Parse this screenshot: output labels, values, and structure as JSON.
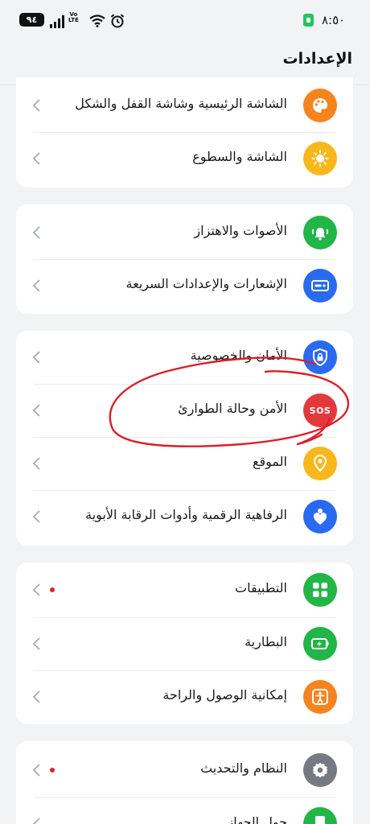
{
  "status_bar": {
    "battery_level": "٩٤",
    "volte_line1": "Vo",
    "volte_line2": "LTE",
    "time": "٨:٥٠"
  },
  "header": {
    "title": "الإعدادات"
  },
  "colors": {
    "orange": "#f5841f",
    "yellow": "#f8b81c",
    "green": "#22b547",
    "blue": "#2a6af0",
    "red": "#e23a3c",
    "gray": "#757a82",
    "annotation_red": "#d9202a"
  },
  "groups": [
    {
      "items": [
        {
          "label": "الشاشة الرئيسية وشاشة القفل والشكل",
          "icon": "palette-icon",
          "color": "#f5841f"
        },
        {
          "label": "الشاشة والسطوع",
          "icon": "sun-icon",
          "color": "#f8b81c"
        }
      ]
    },
    {
      "items": [
        {
          "label": "الأصوات والاهتزاز",
          "icon": "bell-icon",
          "color": "#22b547"
        },
        {
          "label": "الإشعارات والإعدادات السريعة",
          "icon": "notification-icon",
          "color": "#2a6af0"
        }
      ]
    },
    {
      "items": [
        {
          "label": "الأمان والخصوصية",
          "icon": "shield-lock-icon",
          "color": "#2a6af0"
        },
        {
          "label": "الأمن وحالة الطوارئ",
          "icon": "sos-icon",
          "color": "#e23a3c",
          "icon_text": "SOS"
        },
        {
          "label": "الموقع",
          "icon": "location-pin-icon",
          "color": "#f8b81c"
        },
        {
          "label": "الرفاهية الرقمية وأدوات الرقابة الأبوية",
          "icon": "wellbeing-icon",
          "color": "#2a6af0"
        }
      ]
    },
    {
      "items": [
        {
          "label": "التطبيقات",
          "icon": "apps-grid-icon",
          "color": "#22b547",
          "badge": true
        },
        {
          "label": "البطارية",
          "icon": "battery-icon",
          "color": "#22b547"
        },
        {
          "label": "إمكانية الوصول والراحة",
          "icon": "accessibility-icon",
          "color": "#f5841f"
        }
      ]
    },
    {
      "items": [
        {
          "label": "النظام والتحديث",
          "icon": "gear-icon",
          "color": "#757a82",
          "badge": true
        },
        {
          "label": "حول الجهاز",
          "icon": "phone-icon",
          "color": "#22b547"
        }
      ]
    }
  ]
}
